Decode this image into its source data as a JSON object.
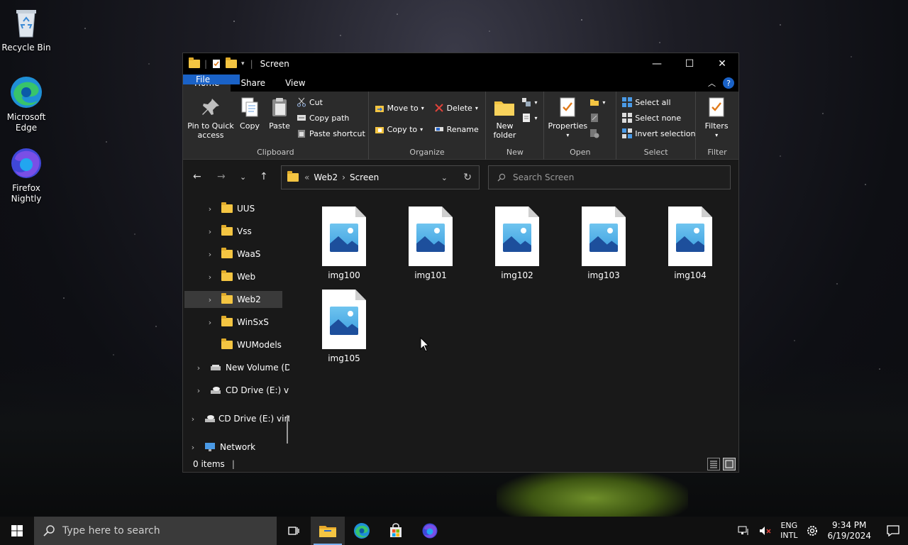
{
  "desktop": {
    "icons": [
      {
        "label": "Recycle Bin"
      },
      {
        "label": "Microsoft Edge"
      },
      {
        "label": "Firefox Nightly"
      }
    ]
  },
  "window": {
    "title": "Screen",
    "tabs": {
      "file": "File",
      "home": "Home",
      "share": "Share",
      "view": "View"
    },
    "ribbon": {
      "clipboard": {
        "label": "Clipboard",
        "pin": "Pin to Quick access",
        "copy": "Copy",
        "paste": "Paste",
        "cut": "Cut",
        "copy_path": "Copy path",
        "paste_shortcut": "Paste shortcut"
      },
      "organize": {
        "label": "Organize",
        "move_to": "Move to",
        "copy_to": "Copy to",
        "delete": "Delete",
        "rename": "Rename"
      },
      "new": {
        "label": "New",
        "new_folder": "New folder"
      },
      "open": {
        "label": "Open",
        "properties": "Properties"
      },
      "select": {
        "label": "Select",
        "select_all": "Select all",
        "select_none": "Select none",
        "invert": "Invert selection"
      },
      "filter": {
        "label": "Filter",
        "filters": "Filters"
      }
    },
    "address": {
      "path": [
        "Web2",
        "Screen"
      ],
      "overflow": "«"
    },
    "search": {
      "placeholder": "Search Screen"
    },
    "tree": [
      {
        "label": "UUS",
        "kind": "folder",
        "expandable": true
      },
      {
        "label": "Vss",
        "kind": "folder",
        "expandable": true
      },
      {
        "label": "WaaS",
        "kind": "folder",
        "expandable": true
      },
      {
        "label": "Web",
        "kind": "folder",
        "expandable": true
      },
      {
        "label": "Web2",
        "kind": "folder",
        "expandable": true,
        "selected": true
      },
      {
        "label": "WinSxS",
        "kind": "folder",
        "expandable": true
      },
      {
        "label": "WUModels",
        "kind": "folder",
        "expandable": false
      },
      {
        "label": "New Volume (D",
        "kind": "drive",
        "expandable": true
      },
      {
        "label": "CD Drive (E:) vi",
        "kind": "cd",
        "expandable": true
      },
      {
        "label": "CD Drive (E:) virti",
        "kind": "cd",
        "expandable": true
      },
      {
        "label": "Network",
        "kind": "network",
        "expandable": true
      }
    ],
    "files": [
      "img100",
      "img101",
      "img102",
      "img103",
      "img104",
      "img105"
    ],
    "status": {
      "items": "0 items"
    }
  },
  "taskbar": {
    "search_placeholder": "Type here to search",
    "lang": {
      "line1": "ENG",
      "line2": "INTL"
    },
    "clock": {
      "time": "9:34 PM",
      "date": "6/19/2024"
    }
  },
  "colors": {
    "accent": "#1a62c7",
    "folder": "#f4c542",
    "ribbon_bg": "#2b2b2b"
  }
}
